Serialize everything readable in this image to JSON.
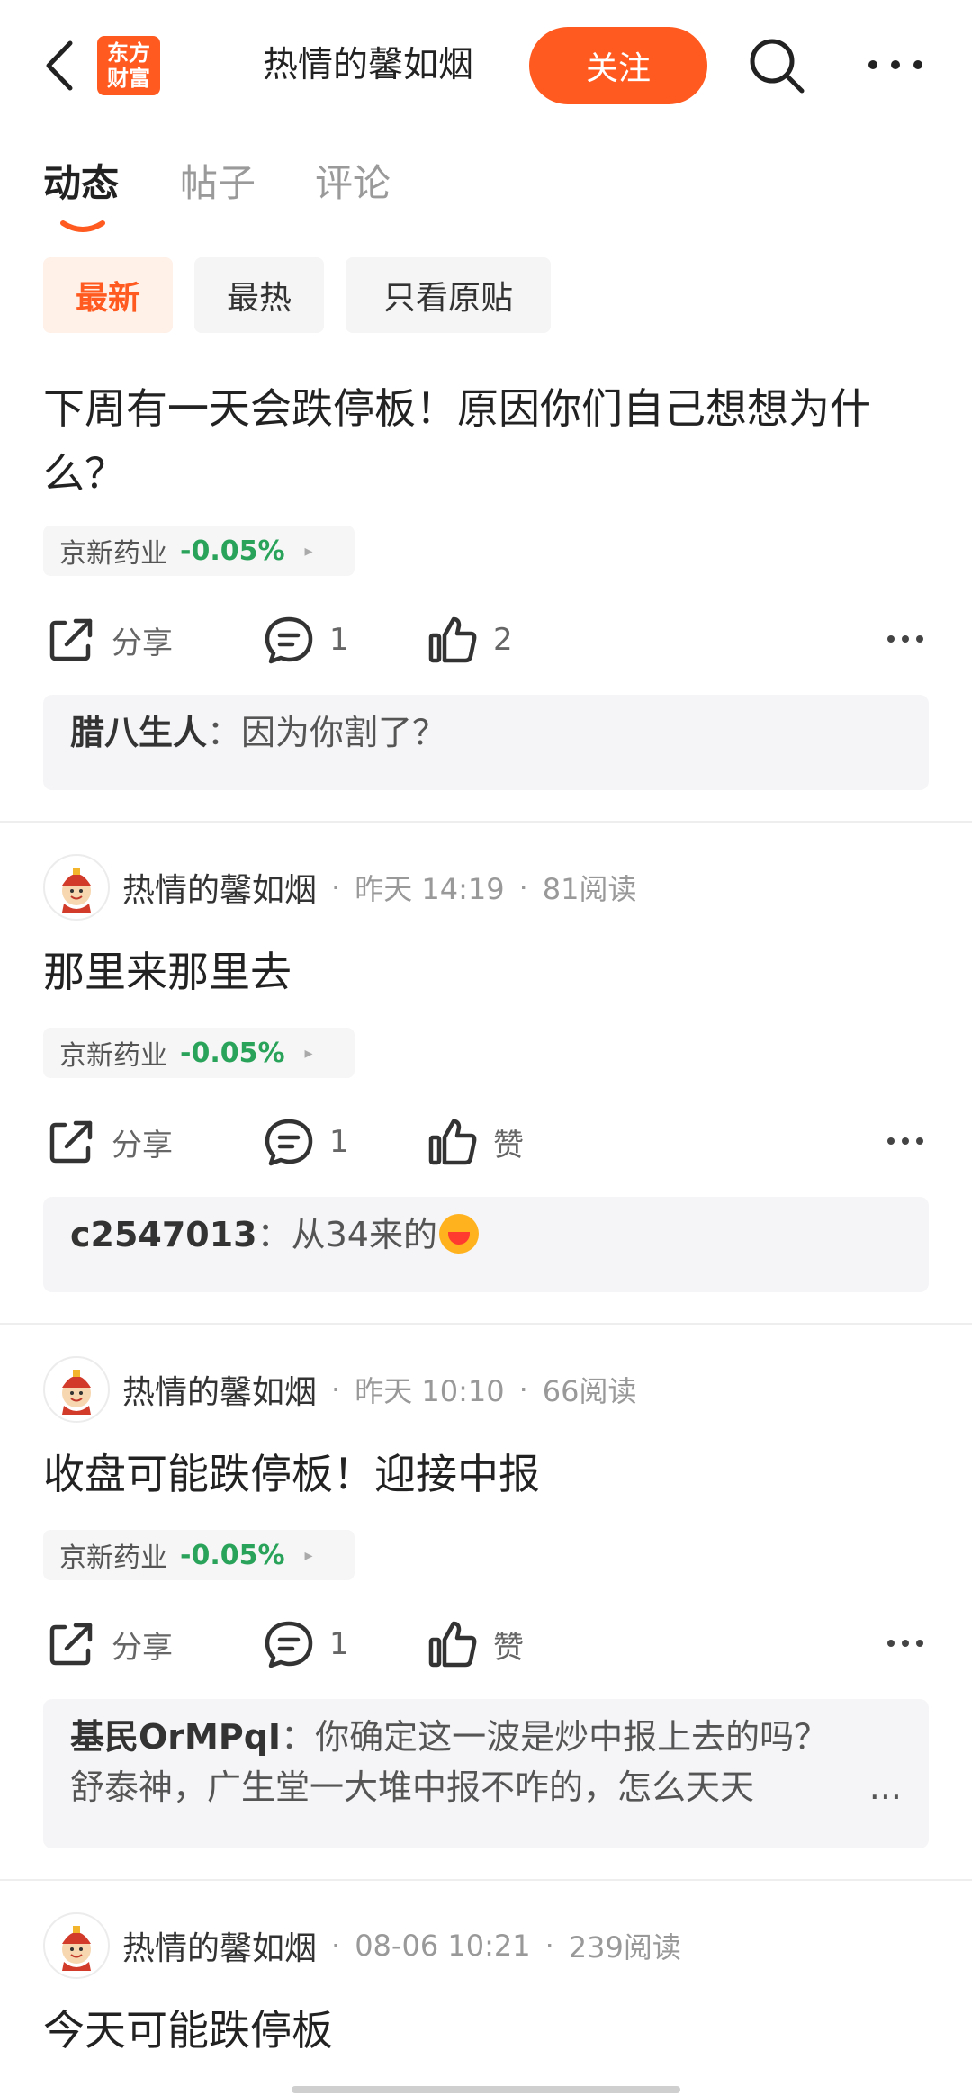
{
  "header": {
    "logo_line1": "东方",
    "logo_line2": "财富",
    "title": "热情的馨如烟",
    "follow_label": "关注"
  },
  "tabs": [
    {
      "label": "动态",
      "active": true
    },
    {
      "label": "帖子",
      "active": false
    },
    {
      "label": "评论",
      "active": false
    }
  ],
  "filters": [
    {
      "label": "最新",
      "active": true
    },
    {
      "label": "最热",
      "active": false
    },
    {
      "label": "只看原贴",
      "active": false
    }
  ],
  "posts": [
    {
      "text": "下周有一天会跌停板！原因你们自己想想为什么？",
      "stock": {
        "name": "京新药业",
        "change": "-0.05%"
      },
      "share_label": "分享",
      "comment_count": "1",
      "like_label": "2",
      "comment": {
        "user": "腊八生人",
        "sep": "：",
        "text": "因为你割了？"
      }
    },
    {
      "author": "热情的馨如烟",
      "time": "昨天 14:19",
      "reads": "81阅读",
      "text": "那里来那里去",
      "stock": {
        "name": "京新药业",
        "change": "-0.05%"
      },
      "share_label": "分享",
      "comment_count": "1",
      "like_label": "赞",
      "comment": {
        "user": "c2547013",
        "sep": "：",
        "text": "从34来的"
      }
    },
    {
      "author": "热情的馨如烟",
      "time": "昨天 10:10",
      "reads": "66阅读",
      "text": "收盘可能跌停板！迎接中报",
      "stock": {
        "name": "京新药业",
        "change": "-0.05%"
      },
      "share_label": "分享",
      "comment_count": "1",
      "like_label": "赞",
      "comment": {
        "user": "基民OrMPqI",
        "sep": "：",
        "text": "你确定这一波是炒中报上去的吗？",
        "text2": "舒泰神，广生堂一大堆中报不咋的，怎么天天",
        "ellipsis": "..."
      }
    },
    {
      "author": "热情的馨如烟",
      "time": "08-06 10:21",
      "reads": "239阅读",
      "text": "今天可能跌停板"
    }
  ],
  "meta_dot": "·",
  "stock_arrow": "▸",
  "colors": {
    "accent": "#ff5a1f",
    "stock_green": "#2aa35a"
  }
}
